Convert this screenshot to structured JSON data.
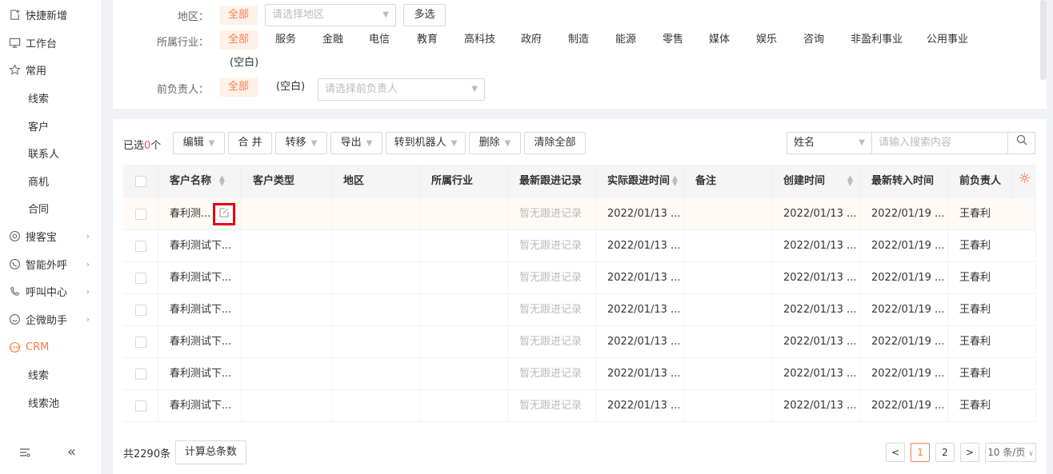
{
  "sidebar": {
    "items": [
      {
        "label": "快捷新增",
        "icon": "quick-add-icon"
      },
      {
        "label": "工作台",
        "icon": "monitor-icon"
      },
      {
        "label": "常用",
        "icon": "star-icon"
      },
      {
        "label": "线索"
      },
      {
        "label": "客户"
      },
      {
        "label": "联系人"
      },
      {
        "label": "商机"
      },
      {
        "label": "合同"
      },
      {
        "label": "搜客宝",
        "icon": "search-treasure-icon"
      },
      {
        "label": "智能外呼",
        "icon": "phone-icon"
      },
      {
        "label": "呼叫中心",
        "icon": "call-center-icon"
      },
      {
        "label": "企微助手",
        "icon": "wecom-icon"
      },
      {
        "label": "CRM",
        "icon": "crm-icon"
      },
      {
        "label": "线索"
      },
      {
        "label": "线索池"
      }
    ],
    "more_arrow": "›",
    "collapse": "«"
  },
  "filters": {
    "region_label": "地区：",
    "region_all": "全部",
    "region_placeholder": "请选择地区",
    "multi_select": "多选",
    "industry_label": "所属行业：",
    "industries": [
      "全部",
      "服务",
      "金融",
      "电信",
      "教育",
      "高科技",
      "政府",
      "制造",
      "能源",
      "零售",
      "媒体",
      "娱乐",
      "咨询",
      "非盈利事业",
      "公用事业"
    ],
    "industry_blank": "(空白)",
    "owner_label": "前负责人：",
    "owner_all": "全部",
    "owner_blank": "(空白)",
    "owner_placeholder": "请选择前负责人"
  },
  "toolbar": {
    "selected_prefix": "已选",
    "selected_count": "0",
    "selected_suffix": "个",
    "edit": "编辑",
    "merge": "合 并",
    "transfer": "转移",
    "export": "导出",
    "to_robot": "转到机器人",
    "delete": "删除",
    "clear_all": "清除全部",
    "search_field": "姓名",
    "search_placeholder": "请输入搜索内容"
  },
  "table": {
    "columns": [
      "客户名称",
      "客户类型",
      "地区",
      "所属行业",
      "最新跟进记录",
      "实际跟进时间",
      "备注",
      "创建时间",
      "最新转入时间",
      "前负责人"
    ],
    "rows": [
      {
        "name": "春利测...",
        "type": "",
        "region": "",
        "industry": "",
        "followup": "暂无跟进记录",
        "actual_time": "2022/01/13 ...",
        "note": "",
        "created": "2022/01/13 ...",
        "transferred": "2022/01/19 ...",
        "owner": "王春利"
      },
      {
        "name": "春利测试下...",
        "type": "",
        "region": "",
        "industry": "",
        "followup": "暂无跟进记录",
        "actual_time": "2022/01/13 ...",
        "note": "",
        "created": "2022/01/13 ...",
        "transferred": "2022/01/19 ...",
        "owner": "王春利"
      },
      {
        "name": "春利测试下...",
        "type": "",
        "region": "",
        "industry": "",
        "followup": "暂无跟进记录",
        "actual_time": "2022/01/13 ...",
        "note": "",
        "created": "2022/01/13 ...",
        "transferred": "2022/01/19 ...",
        "owner": "王春利"
      },
      {
        "name": "春利测试下...",
        "type": "",
        "region": "",
        "industry": "",
        "followup": "暂无跟进记录",
        "actual_time": "2022/01/13 ...",
        "note": "",
        "created": "2022/01/13 ...",
        "transferred": "2022/01/19 ...",
        "owner": "王春利"
      },
      {
        "name": "春利测试下...",
        "type": "",
        "region": "",
        "industry": "",
        "followup": "暂无跟进记录",
        "actual_time": "2022/01/13 ...",
        "note": "",
        "created": "2022/01/13 ...",
        "transferred": "2022/01/19 ...",
        "owner": "王春利"
      },
      {
        "name": "春利测试下...",
        "type": "",
        "region": "",
        "industry": "",
        "followup": "暂无跟进记录",
        "actual_time": "2022/01/13 ...",
        "note": "",
        "created": "2022/01/13 ...",
        "transferred": "2022/01/19 ...",
        "owner": "王春利"
      },
      {
        "name": "春利测试下...",
        "type": "",
        "region": "",
        "industry": "",
        "followup": "暂无跟进记录",
        "actual_time": "2022/01/13 ...",
        "note": "",
        "created": "2022/01/13 ...",
        "transferred": "2022/01/19 ...",
        "owner": "王春利"
      }
    ]
  },
  "footer": {
    "total": "共2290条",
    "calc_total": "计算总条数",
    "prev": "<",
    "pages": [
      "1",
      "2"
    ],
    "next": ">",
    "page_size": "10 条/页"
  },
  "colors": {
    "accent": "#ff7a45",
    "highlight_box": "#e60012"
  }
}
